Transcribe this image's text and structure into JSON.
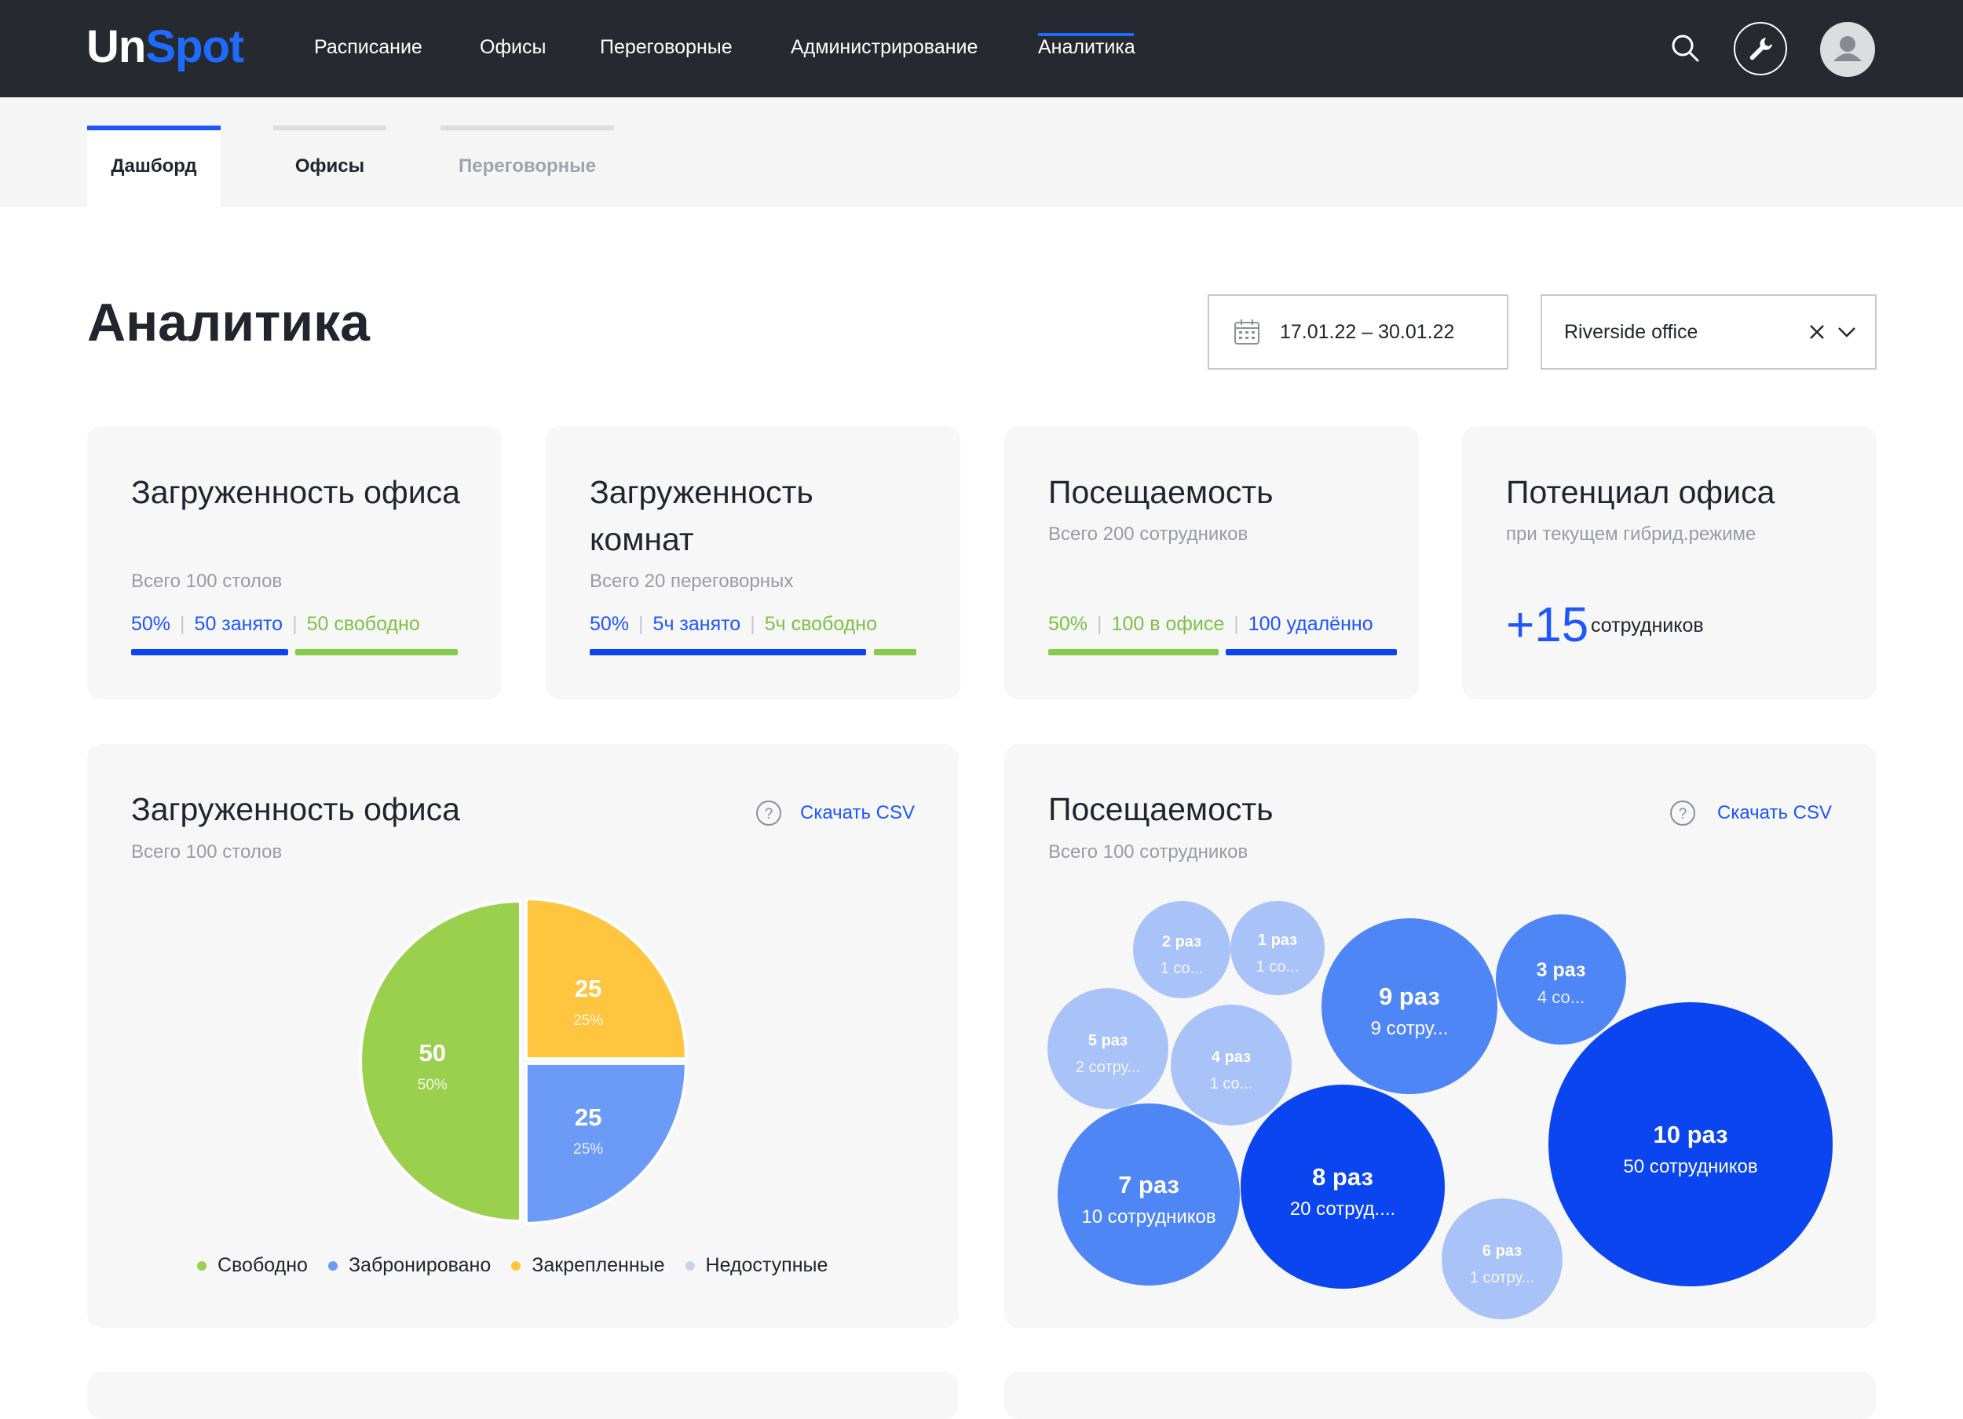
{
  "app": {
    "logo_un": "Un",
    "logo_spot": "Spot"
  },
  "nav": {
    "items": [
      {
        "label": "Расписание"
      },
      {
        "label": "Офисы"
      },
      {
        "label": "Переговорные"
      },
      {
        "label": "Администрирование"
      },
      {
        "label": "Аналитика"
      }
    ],
    "active": "Аналитика"
  },
  "subtabs": [
    {
      "label": "Дашборд"
    },
    {
      "label": "Офисы"
    },
    {
      "label": "Переговорные"
    }
  ],
  "page": {
    "title": "Аналитика"
  },
  "filters": {
    "date_range": "17.01.22 – 30.01.22",
    "office": "Riverside office"
  },
  "kpis": {
    "office_load": {
      "title": "Загруженность офиса",
      "subtitle": "Всего 100 столов",
      "percent": "50%",
      "occupied": "50 занято",
      "free": "50 свободно",
      "occupied_fraction": 0.5
    },
    "rooms_load": {
      "title": "Загруженность комнат",
      "subtitle": "Всего 20 переговорных",
      "percent": "50%",
      "occupied": "5ч занято",
      "free": "5ч свободно",
      "occupied_fraction": 0.86
    },
    "attendance": {
      "title": "Посещаемость",
      "subtitle": "Всего 200 сотрудников",
      "percent": "50%",
      "in_office": "100 в офисе",
      "remote": "100 удалённо",
      "in_office_fraction": 0.5
    },
    "potential": {
      "title": "Потенциал офиса",
      "subtitle": "при текущем гибрид.режиме",
      "value": "+15",
      "unit": "сотрудников"
    }
  },
  "office_chart": {
    "title": "Загруженность офиса",
    "subtitle": "Всего 100 столов",
    "csv_label": "Скачать CSV",
    "legend": [
      {
        "label": "Свободно",
        "color": "#9bd04f"
      },
      {
        "label": "Забронировано",
        "color": "#6b9bf7"
      },
      {
        "label": "Закрепленные",
        "color": "#ffc53e"
      },
      {
        "label": "Недоступные",
        "color": "#c8d3ea"
      }
    ]
  },
  "attendance_chart": {
    "title": "Посещаемость",
    "subtitle": "Всего 100 сотрудников",
    "csv_label": "Скачать CSV"
  },
  "chart_data": [
    {
      "type": "pie",
      "title": "Загруженность офиса",
      "slices": [
        {
          "name": "Закрепленные",
          "value": 25,
          "percent": "25%",
          "color": "#ffc53e"
        },
        {
          "name": "Забронировано",
          "value": 25,
          "percent": "25%",
          "color": "#6b9bf7"
        },
        {
          "name": "Свободно",
          "value": 50,
          "percent": "50%",
          "color": "#9bd04f"
        }
      ]
    },
    {
      "type": "bubble",
      "title": "Посещаемость",
      "bubbles": [
        {
          "label": "10 раз",
          "sub": "50 сотрудников",
          "value": 50,
          "color": "#0a45f0"
        },
        {
          "label": "8 раз",
          "sub": "20 сотруд....",
          "value": 20,
          "color": "#0a45f0"
        },
        {
          "label": "7 раз",
          "sub": "10 сотрудников",
          "value": 10,
          "color": "#4f86f6"
        },
        {
          "label": "9 раз",
          "sub": "9 сотру...",
          "value": 9,
          "color": "#4f86f6"
        },
        {
          "label": "3 раз",
          "sub": "4 со...",
          "value": 4,
          "color": "#4f86f6"
        },
        {
          "label": "5 раз",
          "sub": "2 сотру...",
          "value": 2,
          "color": "#a9c3f9"
        },
        {
          "label": "4 раз",
          "sub": "1 со...",
          "value": 1,
          "color": "#a9c3f9"
        },
        {
          "label": "2 раз",
          "sub": "1 со...",
          "value": 1,
          "color": "#a9c3f9"
        },
        {
          "label": "1 раз",
          "sub": "1 со...",
          "value": 1,
          "color": "#a9c3f9"
        },
        {
          "label": "6 раз",
          "sub": "1 сотру...",
          "value": 1,
          "color": "#a9c3f9"
        }
      ]
    }
  ]
}
